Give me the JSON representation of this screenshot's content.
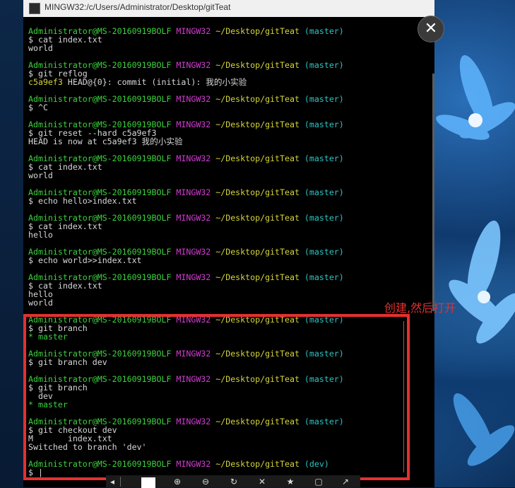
{
  "window": {
    "title": "MINGW32:/c/Users/Administrator/Desktop/gitTeat"
  },
  "annotation": "创建,然后打开",
  "close_icon": "close-icon",
  "lines": [
    {
      "type": "prompt",
      "user": "Administrator@MS-20160919BOLF",
      "host": "MINGW32",
      "path": "~/Desktop/gitTeat",
      "branch": "(master)"
    },
    {
      "type": "cmd",
      "text": "$ cat index.txt"
    },
    {
      "type": "out",
      "text": "world"
    },
    {
      "type": "blank"
    },
    {
      "type": "prompt",
      "user": "Administrator@MS-20160919BOLF",
      "host": "MINGW32",
      "path": "~/Desktop/gitTeat",
      "branch": "(master)"
    },
    {
      "type": "cmd",
      "text": "$ git reflog"
    },
    {
      "type": "reflog",
      "hash": "c5a9ef3",
      "rest": " HEAD@{0}: commit (initial): 我的小实验"
    },
    {
      "type": "blank"
    },
    {
      "type": "prompt",
      "user": "Administrator@MS-20160919BOLF",
      "host": "MINGW32",
      "path": "~/Desktop/gitTeat",
      "branch": "(master)"
    },
    {
      "type": "cmd",
      "text": "$ ^C"
    },
    {
      "type": "blank"
    },
    {
      "type": "prompt",
      "user": "Administrator@MS-20160919BOLF",
      "host": "MINGW32",
      "path": "~/Desktop/gitTeat",
      "branch": "(master)"
    },
    {
      "type": "cmd",
      "text": "$ git reset --hard c5a9ef3"
    },
    {
      "type": "out",
      "text": "HEAD is now at c5a9ef3 我的小实验"
    },
    {
      "type": "blank"
    },
    {
      "type": "prompt",
      "user": "Administrator@MS-20160919BOLF",
      "host": "MINGW32",
      "path": "~/Desktop/gitTeat",
      "branch": "(master)"
    },
    {
      "type": "cmd",
      "text": "$ cat index.txt"
    },
    {
      "type": "out",
      "text": "world"
    },
    {
      "type": "blank"
    },
    {
      "type": "prompt",
      "user": "Administrator@MS-20160919BOLF",
      "host": "MINGW32",
      "path": "~/Desktop/gitTeat",
      "branch": "(master)"
    },
    {
      "type": "cmd",
      "text": "$ echo hello>index.txt"
    },
    {
      "type": "blank"
    },
    {
      "type": "prompt",
      "user": "Administrator@MS-20160919BOLF",
      "host": "MINGW32",
      "path": "~/Desktop/gitTeat",
      "branch": "(master)"
    },
    {
      "type": "cmd",
      "text": "$ cat index.txt"
    },
    {
      "type": "out",
      "text": "hello"
    },
    {
      "type": "blank"
    },
    {
      "type": "prompt",
      "user": "Administrator@MS-20160919BOLF",
      "host": "MINGW32",
      "path": "~/Desktop/gitTeat",
      "branch": "(master)"
    },
    {
      "type": "cmd",
      "text": "$ echo world>>index.txt"
    },
    {
      "type": "blank"
    },
    {
      "type": "prompt",
      "user": "Administrator@MS-20160919BOLF",
      "host": "MINGW32",
      "path": "~/Desktop/gitTeat",
      "branch": "(master)"
    },
    {
      "type": "cmd",
      "text": "$ cat index.txt"
    },
    {
      "type": "out",
      "text": "hello"
    },
    {
      "type": "out",
      "text": "world"
    },
    {
      "type": "blank"
    },
    {
      "type": "prompt",
      "user": "Administrator@MS-20160919BOLF",
      "host": "MINGW32",
      "path": "~/Desktop/gitTeat",
      "branch": "(master)"
    },
    {
      "type": "cmd",
      "text": "$ git branch"
    },
    {
      "type": "current",
      "text": "* master"
    },
    {
      "type": "blank"
    },
    {
      "type": "prompt",
      "user": "Administrator@MS-20160919BOLF",
      "host": "MINGW32",
      "path": "~/Desktop/gitTeat",
      "branch": "(master)"
    },
    {
      "type": "cmd",
      "text": "$ git branch dev"
    },
    {
      "type": "blank"
    },
    {
      "type": "prompt",
      "user": "Administrator@MS-20160919BOLF",
      "host": "MINGW32",
      "path": "~/Desktop/gitTeat",
      "branch": "(master)"
    },
    {
      "type": "cmd",
      "text": "$ git branch"
    },
    {
      "type": "out",
      "text": "  dev"
    },
    {
      "type": "current",
      "text": "* master"
    },
    {
      "type": "blank"
    },
    {
      "type": "prompt",
      "user": "Administrator@MS-20160919BOLF",
      "host": "MINGW32",
      "path": "~/Desktop/gitTeat",
      "branch": "(master)"
    },
    {
      "type": "cmd",
      "text": "$ git checkout dev"
    },
    {
      "type": "out",
      "text": "M       index.txt"
    },
    {
      "type": "out",
      "text": "Switched to branch 'dev'"
    },
    {
      "type": "blank"
    },
    {
      "type": "prompt",
      "user": "Administrator@MS-20160919BOLF",
      "host": "MINGW32",
      "path": "~/Desktop/gitTeat",
      "branch": "(dev)"
    },
    {
      "type": "cmd",
      "text": "$ |"
    }
  ],
  "colors": {
    "user": "#3cd33c",
    "host": "#d23cd2",
    "path": "#d4d43a",
    "branch": "#2ec3c3",
    "highlight": "#e53030"
  },
  "toolbar": {
    "icons": [
      "fit-screen-icon",
      "zoom-in-icon",
      "zoom-out-icon",
      "rotate-icon",
      "delete-icon",
      "favorite-icon",
      "crop-icon",
      "share-icon"
    ]
  }
}
